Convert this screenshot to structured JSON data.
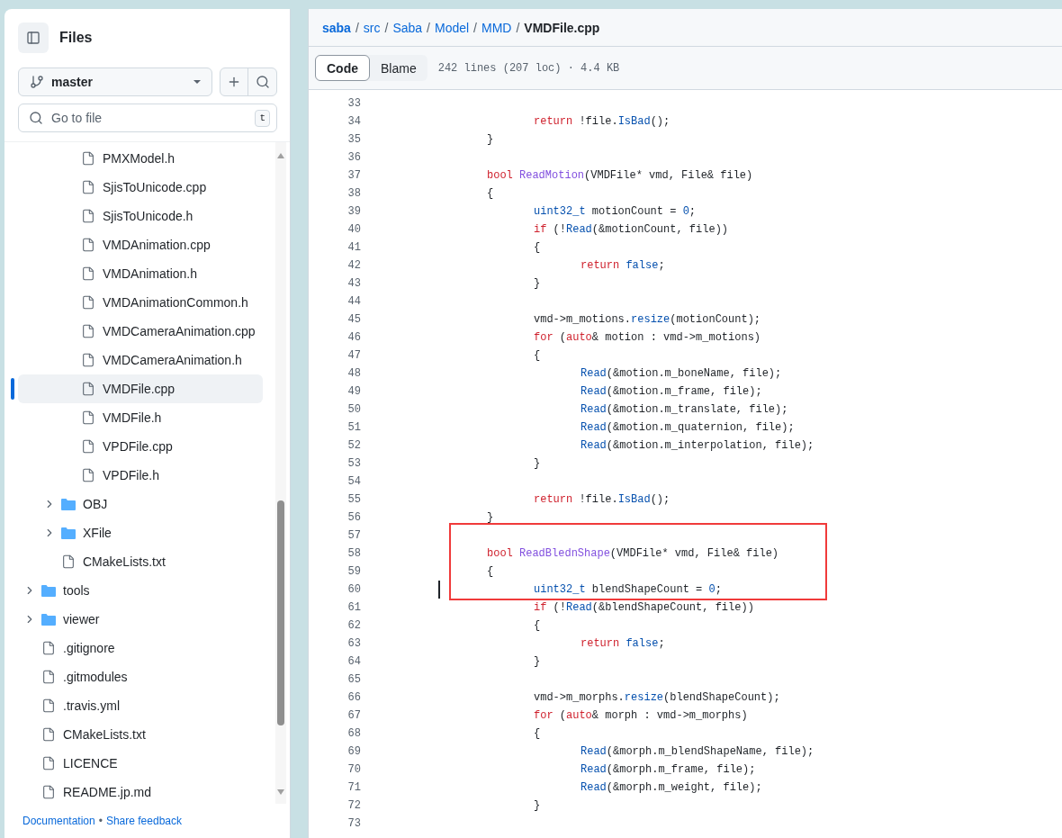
{
  "sidebar": {
    "title": "Files",
    "branch": "master",
    "search": {
      "placeholder": "Go to file",
      "shortcut": "t"
    },
    "tree": [
      {
        "children": [
          {
            "children": [
              {
                "kind": "file",
                "label": "PMXModel.h",
                "selected": false
              },
              {
                "kind": "file",
                "label": "SjisToUnicode.cpp",
                "selected": false
              },
              {
                "kind": "file",
                "label": "SjisToUnicode.h",
                "selected": false
              },
              {
                "kind": "file",
                "label": "VMDAnimation.cpp",
                "selected": false
              },
              {
                "kind": "file",
                "label": "VMDAnimation.h",
                "selected": false
              },
              {
                "kind": "file",
                "label": "VMDAnimationCommon.h",
                "selected": false
              },
              {
                "kind": "file",
                "label": "VMDCameraAnimation.cpp",
                "selected": false
              },
              {
                "kind": "file",
                "label": "VMDCameraAnimation.h",
                "selected": false
              },
              {
                "kind": "file",
                "label": "VMDFile.cpp",
                "selected": true
              },
              {
                "kind": "file",
                "label": "VMDFile.h",
                "selected": false
              },
              {
                "kind": "file",
                "label": "VPDFile.cpp",
                "selected": false
              },
              {
                "kind": "file",
                "label": "VPDFile.h",
                "selected": false
              }
            ]
          },
          {
            "kind": "folder",
            "label": "OBJ",
            "expanded": false,
            "selected": false
          },
          {
            "kind": "folder",
            "label": "XFile",
            "expanded": false,
            "selected": false
          },
          {
            "kind": "file",
            "label": "CMakeLists.txt",
            "selected": false
          }
        ]
      },
      {
        "kind": "folder",
        "label": "tools",
        "expanded": false,
        "selected": false
      },
      {
        "kind": "folder",
        "label": "viewer",
        "expanded": false,
        "selected": false
      },
      {
        "kind": "file",
        "label": ".gitignore",
        "selected": false
      },
      {
        "kind": "file",
        "label": ".gitmodules",
        "selected": false
      },
      {
        "kind": "file",
        "label": ".travis.yml",
        "selected": false
      },
      {
        "kind": "file",
        "label": "CMakeLists.txt",
        "selected": false
      },
      {
        "kind": "file",
        "label": "LICENCE",
        "selected": false
      },
      {
        "kind": "file",
        "label": "README.jp.md",
        "selected": false
      }
    ],
    "footer": {
      "links": [
        "Documentation",
        "Share feedback"
      ],
      "separator": "•"
    }
  },
  "breadcrumb": {
    "parts": [
      "saba",
      "src",
      "Saba",
      "Model",
      "MMD"
    ],
    "separator": "/",
    "current": "VMDFile.cpp"
  },
  "tabs": [
    {
      "label": "Code",
      "selected": true
    },
    {
      "label": "Blame",
      "selected": false
    }
  ],
  "file_info": "242 lines (207 loc) · 4.4 KB",
  "code": [
    {
      "number": "33"
    },
    {
      "number": "34",
      "tokens": [
        {
          "text": "\t\t\treturn",
          "kind": "keyword"
        },
        {
          "text": " !file.",
          "kind": "plain"
        },
        {
          "text": "IsBad",
          "kind": "entity"
        },
        {
          "text": "();",
          "kind": "plain"
        }
      ]
    },
    {
      "number": "35",
      "tokens": [
        {
          "text": "\t\t}",
          "kind": "plain"
        }
      ]
    },
    {
      "number": "36"
    },
    {
      "number": "37",
      "tokens": [
        {
          "text": "\t\tbool ",
          "kind": "keyword"
        },
        {
          "text": "ReadMotion",
          "kind": "function"
        },
        {
          "text": "(VMDFile* vmd, File& file)",
          "kind": "plain"
        }
      ]
    },
    {
      "number": "38",
      "tokens": [
        {
          "text": "\t\t{",
          "kind": "plain"
        }
      ]
    },
    {
      "number": "39",
      "tokens": [
        {
          "text": "\t\t\tuint32_t",
          "kind": "entity"
        },
        {
          "text": " motionCount = ",
          "kind": "plain"
        },
        {
          "text": "0",
          "kind": "entity"
        },
        {
          "text": ";",
          "kind": "plain"
        }
      ]
    },
    {
      "number": "40",
      "tokens": [
        {
          "text": "\t\t\tif",
          "kind": "keyword"
        },
        {
          "text": " (!",
          "kind": "plain"
        },
        {
          "text": "Read",
          "kind": "entity"
        },
        {
          "text": "(&motionCount, file))",
          "kind": "plain"
        }
      ]
    },
    {
      "number": "41",
      "tokens": [
        {
          "text": "\t\t\t{",
          "kind": "plain"
        }
      ]
    },
    {
      "number": "42",
      "tokens": [
        {
          "text": "\t\t\t\treturn ",
          "kind": "keyword"
        },
        {
          "text": "false",
          "kind": "entity"
        },
        {
          "text": ";",
          "kind": "plain"
        }
      ]
    },
    {
      "number": "43",
      "tokens": [
        {
          "text": "\t\t\t}",
          "kind": "plain"
        }
      ]
    },
    {
      "number": "44"
    },
    {
      "number": "45",
      "tokens": [
        {
          "text": "\t\t\tvmd->m_motions.",
          "kind": "plain"
        },
        {
          "text": "resize",
          "kind": "entity"
        },
        {
          "text": "(motionCount);",
          "kind": "plain"
        }
      ]
    },
    {
      "number": "46",
      "tokens": [
        {
          "text": "\t\t\tfor",
          "kind": "keyword"
        },
        {
          "text": " (",
          "kind": "plain"
        },
        {
          "text": "auto",
          "kind": "keyword"
        },
        {
          "text": "& motion : vmd->m_motions)",
          "kind": "plain"
        }
      ]
    },
    {
      "number": "47",
      "tokens": [
        {
          "text": "\t\t\t{",
          "kind": "plain"
        }
      ]
    },
    {
      "number": "48",
      "tokens": [
        {
          "text": "\t\t\t\tRead",
          "kind": "entity"
        },
        {
          "text": "(&motion.m_boneName, file);",
          "kind": "plain"
        }
      ]
    },
    {
      "number": "49",
      "tokens": [
        {
          "text": "\t\t\t\tRead",
          "kind": "entity"
        },
        {
          "text": "(&motion.m_frame, file);",
          "kind": "plain"
        }
      ]
    },
    {
      "number": "50",
      "tokens": [
        {
          "text": "\t\t\t\tRead",
          "kind": "entity"
        },
        {
          "text": "(&motion.m_translate, file);",
          "kind": "plain"
        }
      ]
    },
    {
      "number": "51",
      "tokens": [
        {
          "text": "\t\t\t\tRead",
          "kind": "entity"
        },
        {
          "text": "(&motion.m_quaternion, file);",
          "kind": "plain"
        }
      ]
    },
    {
      "number": "52",
      "tokens": [
        {
          "text": "\t\t\t\tRead",
          "kind": "entity"
        },
        {
          "text": "(&motion.m_interpolation, file);",
          "kind": "plain"
        }
      ]
    },
    {
      "number": "53",
      "tokens": [
        {
          "text": "\t\t\t}",
          "kind": "plain"
        }
      ]
    },
    {
      "number": "54"
    },
    {
      "number": "55",
      "tokens": [
        {
          "text": "\t\t\treturn",
          "kind": "keyword"
        },
        {
          "text": " !file.",
          "kind": "plain"
        },
        {
          "text": "IsBad",
          "kind": "entity"
        },
        {
          "text": "();",
          "kind": "plain"
        }
      ]
    },
    {
      "number": "56",
      "tokens": [
        {
          "text": "\t\t}",
          "kind": "plain"
        }
      ]
    },
    {
      "number": "57",
      "highlighted": true
    },
    {
      "number": "58",
      "highlighted": true,
      "tokens": [
        {
          "text": "\t\tbool ",
          "kind": "keyword"
        },
        {
          "text": "ReadBlednShape",
          "kind": "function"
        },
        {
          "text": "(VMDFile* vmd, File& file)",
          "kind": "plain"
        }
      ]
    },
    {
      "number": "59",
      "highlighted": true,
      "tokens": [
        {
          "text": "\t\t{",
          "kind": "plain"
        }
      ]
    },
    {
      "number": "60",
      "highlighted": true,
      "cursor": true,
      "tokens": [
        {
          "text": "\t\t\tuint32_t",
          "kind": "entity"
        },
        {
          "text": " blendShapeCount = ",
          "kind": "plain"
        },
        {
          "text": "0",
          "kind": "entity"
        },
        {
          "text": ";",
          "kind": "plain"
        }
      ]
    },
    {
      "number": "61",
      "tokens": [
        {
          "text": "\t\t\tif",
          "kind": "keyword"
        },
        {
          "text": " (!",
          "kind": "plain"
        },
        {
          "text": "Read",
          "kind": "entity"
        },
        {
          "text": "(&blendShapeCount, file))",
          "kind": "plain"
        }
      ]
    },
    {
      "number": "62",
      "tokens": [
        {
          "text": "\t\t\t{",
          "kind": "plain"
        }
      ]
    },
    {
      "number": "63",
      "tokens": [
        {
          "text": "\t\t\t\treturn ",
          "kind": "keyword"
        },
        {
          "text": "false",
          "kind": "entity"
        },
        {
          "text": ";",
          "kind": "plain"
        }
      ]
    },
    {
      "number": "64",
      "tokens": [
        {
          "text": "\t\t\t}",
          "kind": "plain"
        }
      ]
    },
    {
      "number": "65"
    },
    {
      "number": "66",
      "tokens": [
        {
          "text": "\t\t\tvmd->m_morphs.",
          "kind": "plain"
        },
        {
          "text": "resize",
          "kind": "entity"
        },
        {
          "text": "(blendShapeCount);",
          "kind": "plain"
        }
      ]
    },
    {
      "number": "67",
      "tokens": [
        {
          "text": "\t\t\tfor",
          "kind": "keyword"
        },
        {
          "text": " (",
          "kind": "plain"
        },
        {
          "text": "auto",
          "kind": "keyword"
        },
        {
          "text": "& morph : vmd->m_morphs)",
          "kind": "plain"
        }
      ]
    },
    {
      "number": "68",
      "tokens": [
        {
          "text": "\t\t\t{",
          "kind": "plain"
        }
      ]
    },
    {
      "number": "69",
      "tokens": [
        {
          "text": "\t\t\t\tRead",
          "kind": "entity"
        },
        {
          "text": "(&morph.m_blendShapeName, file);",
          "kind": "plain"
        }
      ]
    },
    {
      "number": "70",
      "tokens": [
        {
          "text": "\t\t\t\tRead",
          "kind": "entity"
        },
        {
          "text": "(&morph.m_frame, file);",
          "kind": "plain"
        }
      ]
    },
    {
      "number": "71",
      "tokens": [
        {
          "text": "\t\t\t\tRead",
          "kind": "entity"
        },
        {
          "text": "(&morph.m_weight, file);",
          "kind": "plain"
        }
      ]
    },
    {
      "number": "72",
      "tokens": [
        {
          "text": "\t\t\t}",
          "kind": "plain"
        }
      ]
    },
    {
      "number": "73"
    }
  ]
}
